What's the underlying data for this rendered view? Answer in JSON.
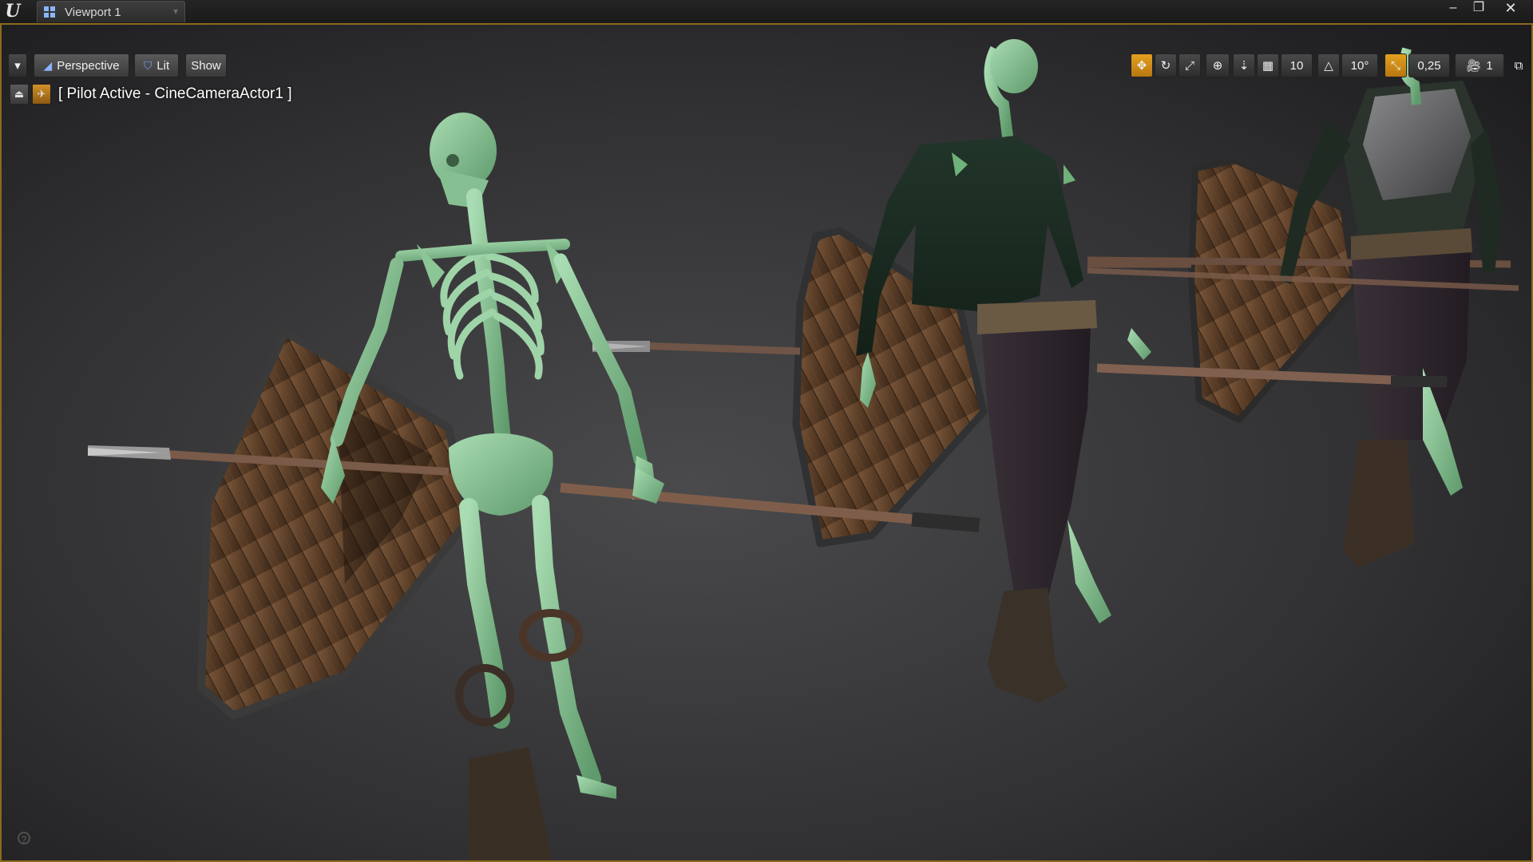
{
  "window": {
    "tab_title": "Viewport 1",
    "controls": {
      "minimize": "–",
      "maximize": "❐",
      "close": "✕"
    }
  },
  "toolbar_left": {
    "menu_glyph": "▾",
    "perspective_label": "Perspective",
    "lit_label": "Lit",
    "show_label": "Show"
  },
  "toolbar_right": {
    "grid_snap_value": "10",
    "rotation_snap_value": "10°",
    "scale_snap_value": "0,25",
    "camera_speed_value": "1"
  },
  "pilot": {
    "label": "[ Pilot Active - CineCameraActor1 ]"
  },
  "colors": {
    "accent": "#e5a020",
    "frame": "#8a6a1e",
    "bone": "#8fc99a",
    "wood": "#6b4a2e"
  },
  "icons": {
    "translate": "move-icon",
    "rotate": "rotate-icon",
    "scale": "scale-icon",
    "world": "globe-icon",
    "surface_snap": "surface-snap-icon",
    "grid": "grid-icon",
    "angle": "angle-icon",
    "scale_snap": "scale-snap-icon",
    "camera": "camera-icon",
    "maximize_viewport": "maximize-viewport-icon"
  }
}
